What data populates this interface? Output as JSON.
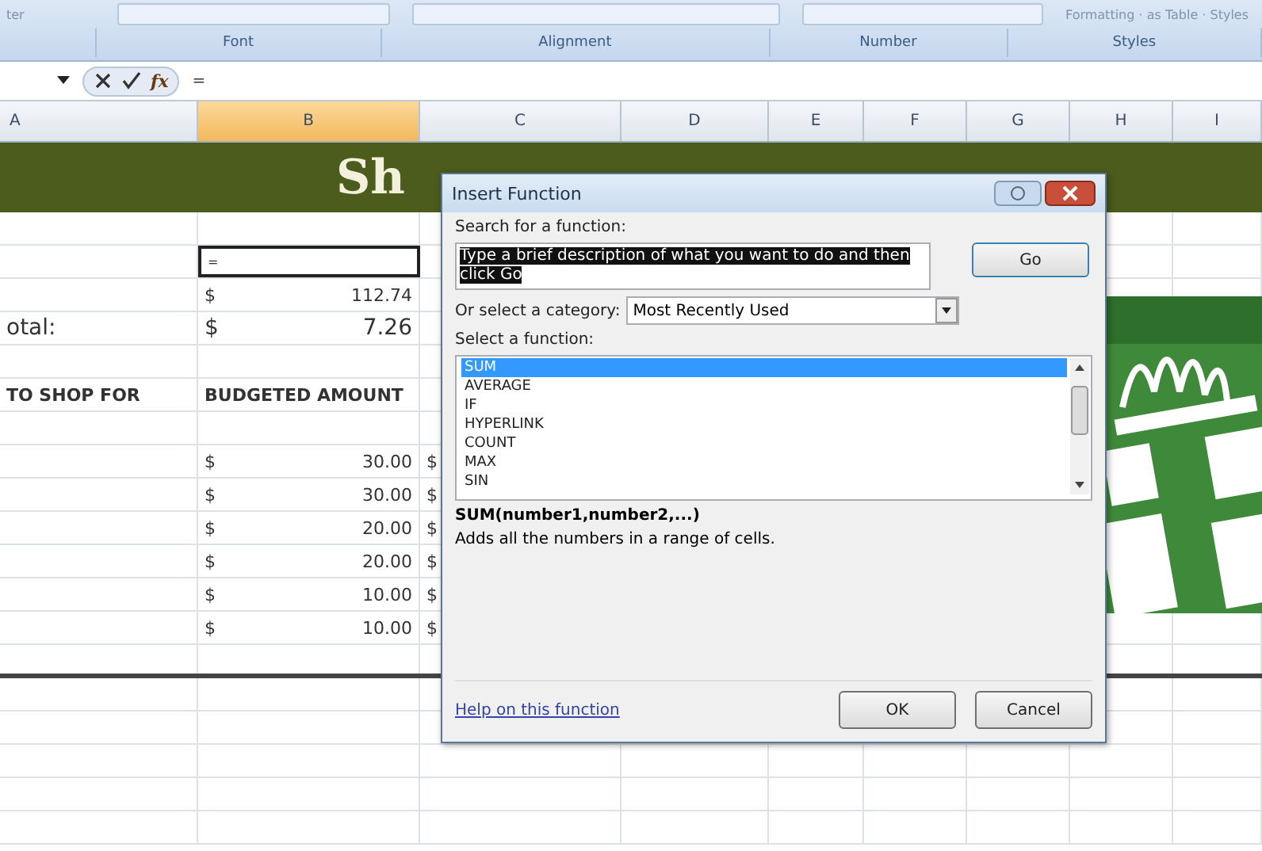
{
  "ribbon": {
    "corner_text": "ter",
    "styles_caption": "Formatting · as Table · Styles",
    "groups": [
      {
        "label": "Font"
      },
      {
        "label": "Alignment"
      },
      {
        "label": "Number"
      },
      {
        "label": "Styles"
      }
    ]
  },
  "formula_bar": {
    "function_button": "fx",
    "value": "="
  },
  "columns": [
    {
      "label": "A",
      "selected": false
    },
    {
      "label": "B",
      "selected": true
    },
    {
      "label": "C",
      "selected": false
    },
    {
      "label": "D",
      "selected": false
    },
    {
      "label": "E",
      "selected": false
    },
    {
      "label": "F",
      "selected": false
    },
    {
      "label": "G",
      "selected": false
    },
    {
      "label": "H",
      "selected": false
    },
    {
      "label": "I",
      "selected": false
    }
  ],
  "banner": {
    "title": "Sh"
  },
  "rows": [
    {
      "kind": "blank"
    },
    {
      "kind": "cells",
      "b": "=",
      "active": true
    },
    {
      "kind": "cells",
      "b_sign": "$",
      "b_value": "112.74"
    },
    {
      "kind": "cells",
      "a": "otal:",
      "b_sign": "$",
      "b_value": "7.26",
      "large": true
    },
    {
      "kind": "blank"
    },
    {
      "kind": "header",
      "a": "TO SHOP FOR",
      "b": "BUDGETED AMOUNT"
    },
    {
      "kind": "blank"
    },
    {
      "kind": "cells",
      "b_sign": "$",
      "b_value": "30.00",
      "c": "$"
    },
    {
      "kind": "cells",
      "b_sign": "$",
      "b_value": "30.00",
      "c": "$"
    },
    {
      "kind": "cells",
      "b_sign": "$",
      "b_value": "20.00",
      "c": "$"
    },
    {
      "kind": "cells",
      "b_sign": "$",
      "b_value": "20.00",
      "c": "$"
    },
    {
      "kind": "cells",
      "b_sign": "$",
      "b_value": "10.00",
      "c": "$"
    },
    {
      "kind": "cells",
      "b_sign": "$",
      "b_value": "10.00",
      "c": "$"
    },
    {
      "kind": "blank",
      "thick_bottom": true
    },
    {
      "kind": "blank"
    },
    {
      "kind": "blank"
    },
    {
      "kind": "blank"
    },
    {
      "kind": "blank"
    },
    {
      "kind": "blank"
    }
  ],
  "dialog": {
    "title": "Insert Function",
    "search_label": "Search for a function:",
    "search_value": "Type a brief description of what you want to do and then click Go",
    "go_button": "Go",
    "category_label": "Or select a category:",
    "category_value": "Most Recently Used",
    "function_label": "Select a function:",
    "functions": [
      {
        "name": "SUM",
        "selected": true
      },
      {
        "name": "AVERAGE",
        "selected": false
      },
      {
        "name": "IF",
        "selected": false
      },
      {
        "name": "HYPERLINK",
        "selected": false
      },
      {
        "name": "COUNT",
        "selected": false
      },
      {
        "name": "MAX",
        "selected": false
      },
      {
        "name": "SIN",
        "selected": false
      }
    ],
    "signature": "SUM(number1,number2,...)",
    "description": "Adds all the numbers in a range of cells.",
    "help_link": "Help on this function",
    "buttons": [
      "OK",
      "Cancel"
    ]
  }
}
